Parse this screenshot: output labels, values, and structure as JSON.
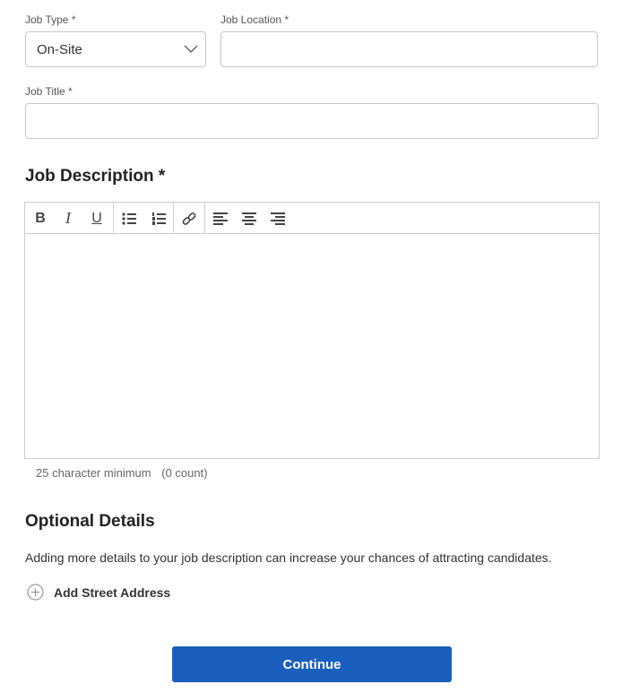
{
  "job_type": {
    "label": "Job Type *",
    "value": "On-Site"
  },
  "job_location": {
    "label": "Job Location *",
    "value": ""
  },
  "job_title": {
    "label": "Job Title *",
    "value": ""
  },
  "description": {
    "heading": "Job Description *",
    "hint": "25 character minimum",
    "count": "(0 count)",
    "toolbar": {
      "bold": "B",
      "italic": "I",
      "underline": "U"
    }
  },
  "optional": {
    "heading": "Optional Details",
    "text": "Adding more details to your job description can increase your chances of attracting candidates.",
    "add_address": "Add Street Address"
  },
  "continue": "Continue",
  "colors": {
    "primary": "#1b5fbe"
  }
}
